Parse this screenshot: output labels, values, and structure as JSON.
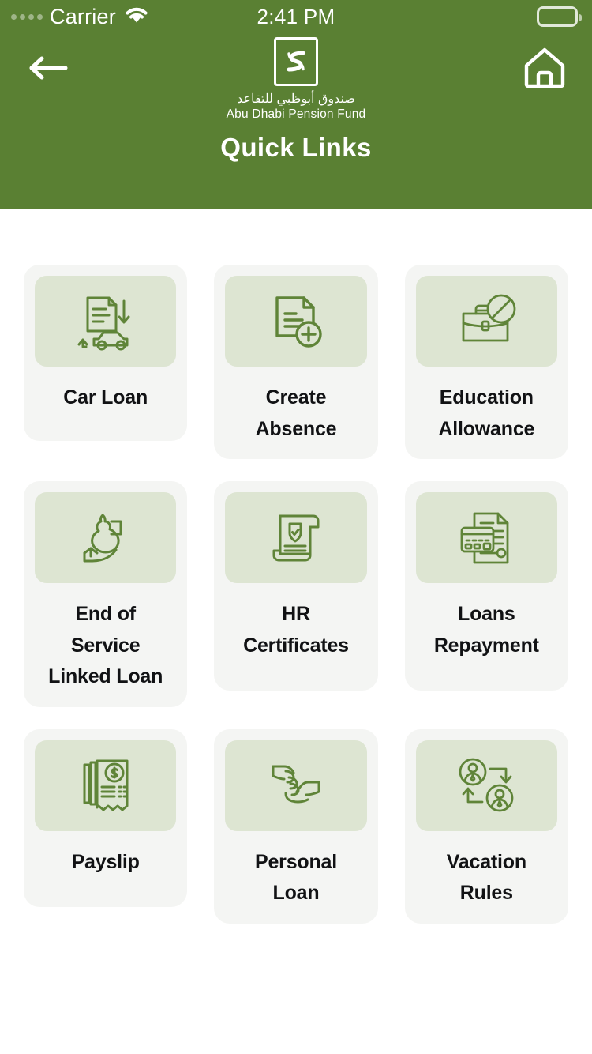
{
  "status_bar": {
    "carrier": "Carrier",
    "time": "2:41 PM",
    "signal_icon": "signal-dots-icon",
    "wifi_icon": "wifi-icon",
    "battery_icon": "battery-full-icon"
  },
  "header": {
    "background_color": "#5a8033",
    "back_icon": "back-arrow-icon",
    "home_icon": "home-icon",
    "logo": {
      "mark_icon": "abu-dhabi-pension-fund-logo-icon",
      "arabic_name": "صندوق أبوظبي للتقاعد",
      "english_name": "Abu Dhabi Pension Fund"
    },
    "title": "Quick Links"
  },
  "theme": {
    "tile_background": "#f4f5f3",
    "icon_panel_background": "#dde5d2",
    "icon_stroke": "#5f8438",
    "label_color": "#111214"
  },
  "grid": {
    "tiles": [
      {
        "label": "Car Loan",
        "icon": "car-loan-icon",
        "row": 1
      },
      {
        "label": "Create\nAbsence",
        "icon": "create-absence-icon",
        "row": 1
      },
      {
        "label": "Education\nAllowance",
        "icon": "education-allowance-icon",
        "row": 1
      },
      {
        "label": "End of\nService\nLinked Loan",
        "icon": "end-of-service-linked-loan-icon",
        "row": 2
      },
      {
        "label": "HR\nCertificates",
        "icon": "hr-certificates-icon",
        "row": 2
      },
      {
        "label": "Loans\nRepayment",
        "icon": "loans-repayment-icon",
        "row": 2
      },
      {
        "label": "Payslip",
        "icon": "payslip-icon",
        "row": 3
      },
      {
        "label": "Personal\nLoan",
        "icon": "personal-loan-icon",
        "row": 3
      },
      {
        "label": "Vacation\nRules",
        "icon": "vacation-rules-icon",
        "row": 3
      }
    ]
  }
}
